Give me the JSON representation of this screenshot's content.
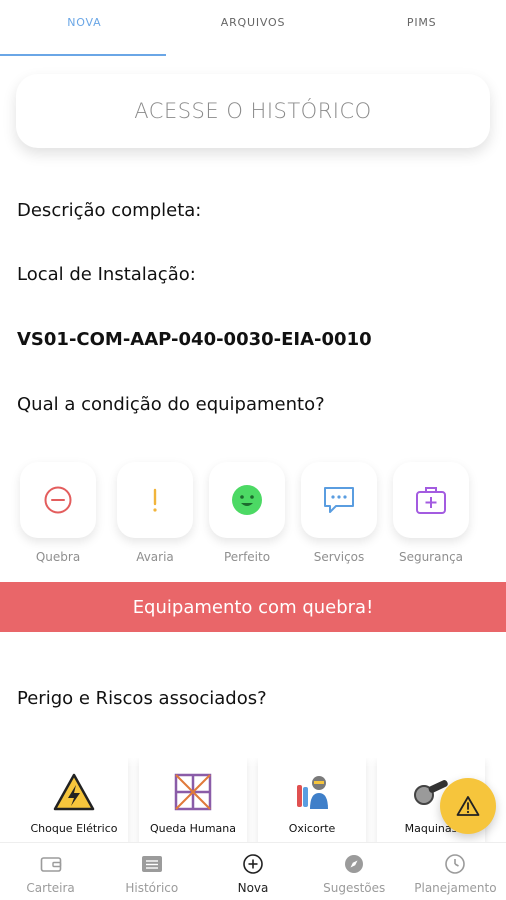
{
  "tabs": [
    {
      "label": "NOVA",
      "active": true
    },
    {
      "label": "ARQUIVOS",
      "active": false
    },
    {
      "label": "PIMS",
      "active": false
    }
  ],
  "history_button": "ACESSE O HISTÓRICO",
  "descricao_label": "Descrição completa:",
  "local_label": "Local de Instalação:",
  "equipment_code": "VS01-COM-AAP-040-0030-EIA-0010",
  "condition_question": "Qual a condição do equipamento?",
  "conditions": [
    {
      "label": "Quebra",
      "icon": "minus-circle-icon",
      "color": "#e35d5d"
    },
    {
      "label": "Avaria",
      "icon": "exclamation-icon",
      "color": "#f1b43b"
    },
    {
      "label": "Perfeito",
      "icon": "smiley-icon",
      "color": "#4cd964"
    },
    {
      "label": "Serviços",
      "icon": "chat-bubble-icon",
      "color": "#5a9de0"
    },
    {
      "label": "Segurança",
      "icon": "first-aid-kit-icon",
      "color": "#a35be0"
    }
  ],
  "alert_banner": "Equipamento com quebra!",
  "risk_question": "Perigo e Riscos associados?",
  "risks": [
    {
      "label": "Choque Elétrico",
      "icon": "electric-hazard-icon"
    },
    {
      "label": "Queda Humana",
      "icon": "scaffold-icon"
    },
    {
      "label": "Oxicorte",
      "icon": "welder-icon"
    },
    {
      "label": "Maquinas",
      "icon": "grinder-icon"
    }
  ],
  "bottom_nav": [
    {
      "label": "Carteira",
      "icon": "wallet-icon",
      "active": false
    },
    {
      "label": "Histórico",
      "icon": "history-list-icon",
      "active": false
    },
    {
      "label": "Nova",
      "icon": "plus-circle-icon",
      "active": true
    },
    {
      "label": "Sugestões",
      "icon": "compass-icon",
      "active": false
    },
    {
      "label": "Planejamento",
      "icon": "clock-icon",
      "active": false
    }
  ],
  "colors": {
    "accent": "#6aa6e6",
    "alert": "#e96669",
    "fab": "#f6c53c"
  }
}
